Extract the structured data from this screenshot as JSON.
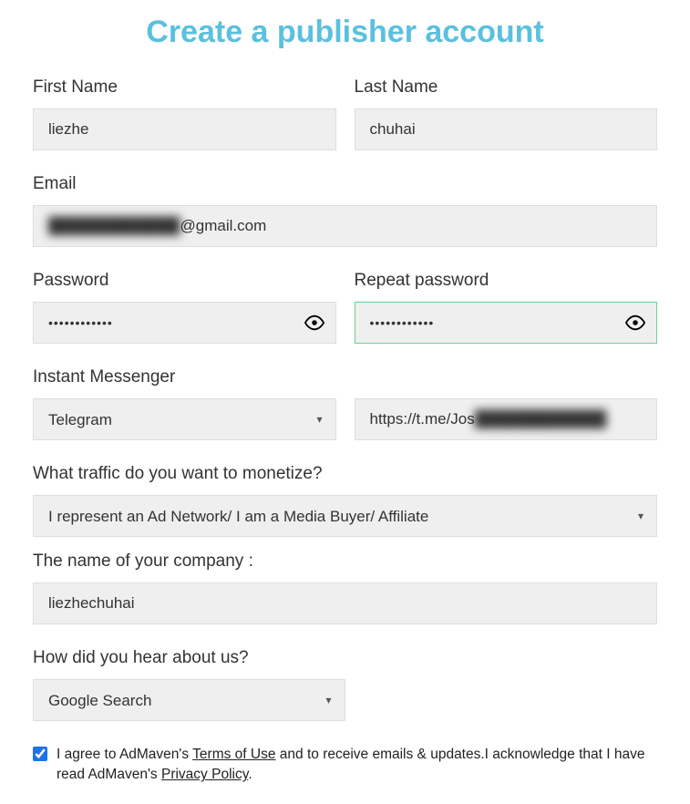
{
  "title": "Create a publisher account",
  "first_name": {
    "label": "First Name",
    "value": "liezhe"
  },
  "last_name": {
    "label": "Last Name",
    "value": "chuhai"
  },
  "email": {
    "label": "Email",
    "value_prefix": "████████████",
    "value_suffix": "@gmail.com"
  },
  "password": {
    "label": "Password",
    "value": "••••••••••••"
  },
  "repeat_password": {
    "label": "Repeat password",
    "value": "••••••••••••"
  },
  "im": {
    "label": "Instant Messenger",
    "type_value": "Telegram",
    "handle_prefix": "https://t.me/Jos",
    "handle_suffix": "████████████"
  },
  "traffic": {
    "label": "What traffic do you want to monetize?",
    "value": "I represent an Ad Network/ I am a Media Buyer/ Affiliate"
  },
  "company": {
    "label": "The name of your company :",
    "value": "liezhechuhai"
  },
  "hear_about": {
    "label": "How did you hear about us?",
    "value": "Google Search"
  },
  "consent": {
    "checked": true,
    "part1": "I agree to AdMaven's ",
    "terms": "Terms of Use",
    "part2": " and to receive emails & updates.I acknowledge that I have read AdMaven's ",
    "privacy": "Privacy Policy",
    "part3": "."
  }
}
